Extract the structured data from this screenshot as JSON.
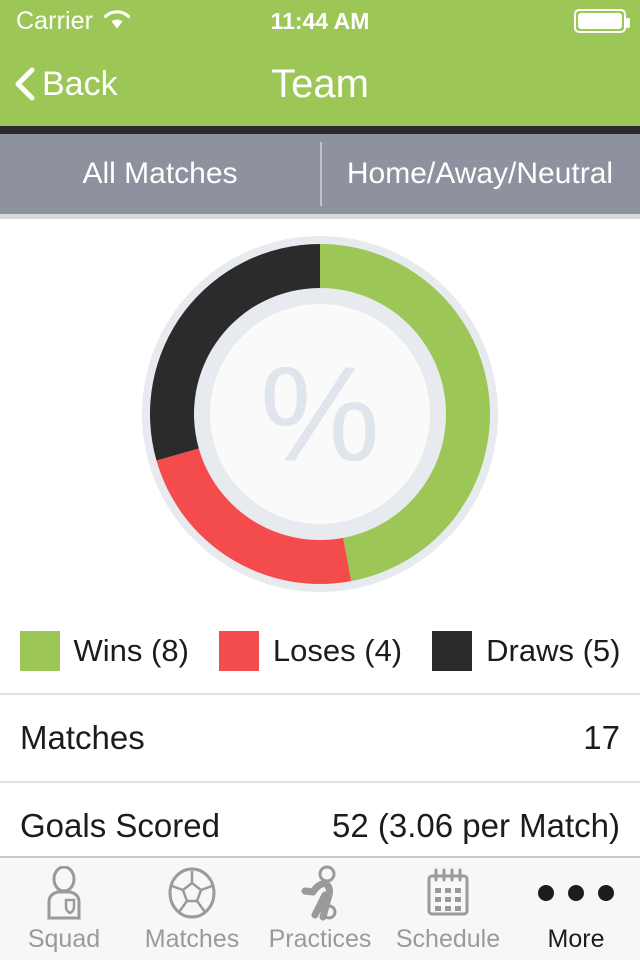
{
  "status_bar": {
    "carrier": "Carrier",
    "wifi_icon": "wifi-icon",
    "time": "11:44 AM",
    "battery_icon": "battery-full-icon"
  },
  "nav": {
    "back_label": "Back",
    "back_icon": "chevron-left-icon",
    "title": "Team"
  },
  "segmented_control": {
    "options": [
      {
        "label": "All Matches",
        "selected": true
      },
      {
        "label": "Home/Away/Neutral",
        "selected": false
      }
    ]
  },
  "chart_data": {
    "type": "pie",
    "title": "",
    "center_glyph": "%",
    "total": 17,
    "categories": [
      "Wins",
      "Loses",
      "Draws"
    ],
    "values": [
      8,
      4,
      5
    ],
    "colors": [
      "#9CC757",
      "#F44C4C",
      "#2B2B2B"
    ],
    "legend": [
      {
        "label": "Wins (8)",
        "color": "#9CC757",
        "value": 8
      },
      {
        "label": "Loses (4)",
        "color": "#F44C4C",
        "value": 4
      },
      {
        "label": "Draws (5)",
        "color": "#2B2B2B",
        "value": 5
      }
    ],
    "legend_position": "bottom",
    "grid": false
  },
  "stats": {
    "rows": [
      {
        "label": "Matches",
        "value": "17"
      },
      {
        "label": "Goals Scored",
        "value": "52 (3.06 per Match)"
      }
    ]
  },
  "tab_bar": {
    "tabs": [
      {
        "label": "Squad",
        "icon": "player-shirt-icon",
        "active": false
      },
      {
        "label": "Matches",
        "icon": "soccer-ball-icon",
        "active": false
      },
      {
        "label": "Practices",
        "icon": "running-player-icon",
        "active": false
      },
      {
        "label": "Schedule",
        "icon": "calendar-icon",
        "active": false
      },
      {
        "label": "More",
        "icon": "ellipsis-icon",
        "active": true
      }
    ]
  },
  "theme": {
    "brand_green": "#9CC757",
    "segment_gray": "#8E929E",
    "dark": "#2B2B2B",
    "red": "#F44C4C"
  }
}
